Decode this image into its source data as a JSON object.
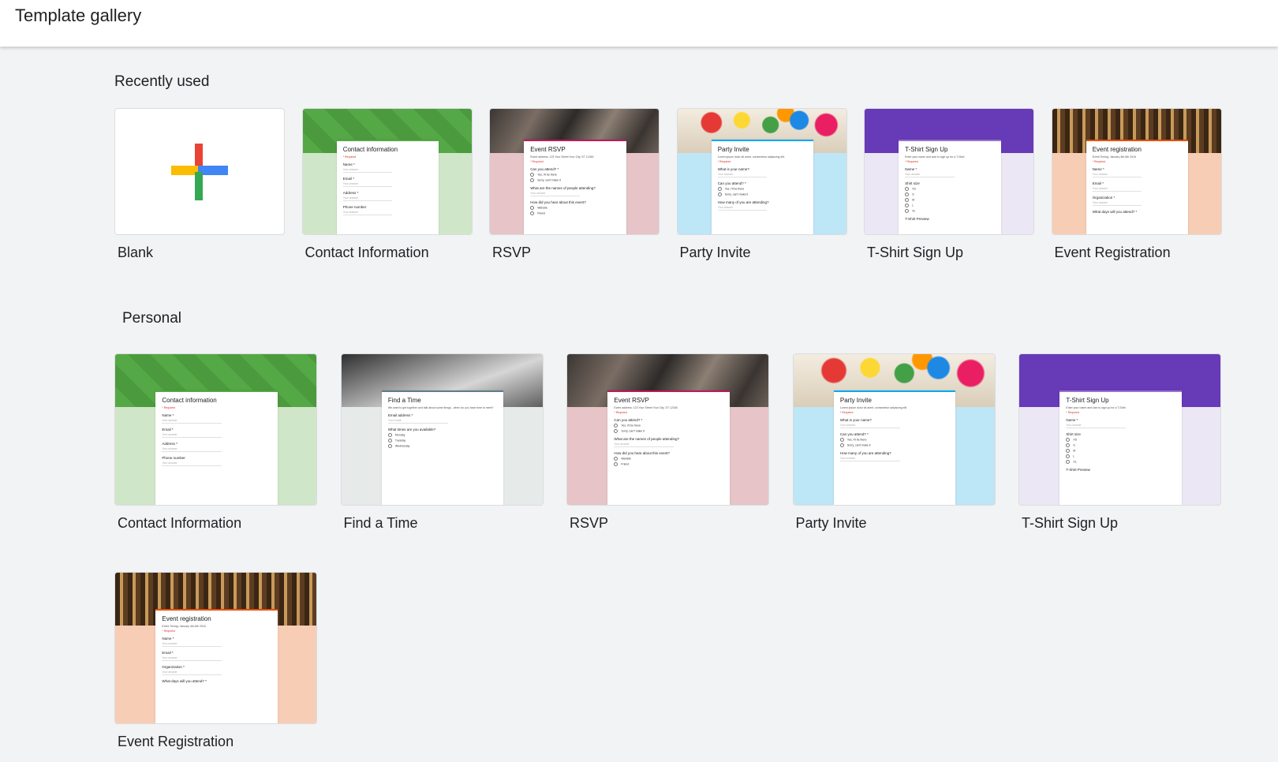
{
  "header": {
    "title": "Template gallery"
  },
  "sections": {
    "recent": "Recently used",
    "personal": "Personal"
  },
  "colors": {
    "contact": {
      "band": "#55a846",
      "body": "#d0e6c8",
      "accent": "#55a846"
    },
    "rsvp": {
      "band": "#4a4440",
      "body": "#e6c4c7",
      "accent": "#c2185b"
    },
    "party": {
      "band": "#e8d9c0",
      "body": "#bde6f6",
      "accent": "#03a9f4"
    },
    "tshirt": {
      "band": "#673ab7",
      "body": "#ece7f5",
      "accent": "#9575cd"
    },
    "event": {
      "band": "#6b4a2a",
      "body": "#f8cdb5",
      "accent": "#e65100"
    },
    "findtime": {
      "band": "#6d6d6d",
      "body": "#e6ebe9",
      "accent": "#607d8b"
    }
  },
  "templates": {
    "blank": {
      "label": "Blank",
      "icon": "plus-icon"
    },
    "contact": {
      "label": "Contact Information",
      "form_title": "Contact information",
      "required": "* Required",
      "fields": [
        {
          "q": "Name *",
          "a": "Your answer"
        },
        {
          "q": "Email *",
          "a": "Your answer"
        },
        {
          "q": "Address *",
          "a": "Your answer"
        },
        {
          "q": "Phone number",
          "a": "Your answer"
        }
      ]
    },
    "rsvp": {
      "label": "RSVP",
      "form_title": "Event RSVP",
      "desc": "Event address: 123 Your Street Your City, ST 12345",
      "required": "* Required",
      "fields": [
        {
          "q": "Can you attend? *",
          "opts": [
            "Yes, I'll be there",
            "Sorry, can't make it"
          ]
        },
        {
          "q": "What are the names of people attending?",
          "a": "Your answer"
        },
        {
          "q": "How did you hear about this event?",
          "opts": [
            "Website",
            "Friend"
          ]
        }
      ]
    },
    "party": {
      "label": "Party Invite",
      "form_title": "Party Invite",
      "desc": "Lorem ipsum dolor sit amet, consectetur adipiscing elit.",
      "required": "* Required",
      "fields": [
        {
          "q": "What is your name?",
          "a": "Your answer"
        },
        {
          "q": "Can you attend? *",
          "opts": [
            "Yes, I'll be there",
            "Sorry, can't make it"
          ]
        },
        {
          "q": "How many of you are attending?",
          "a": "Your answer"
        }
      ]
    },
    "tshirt": {
      "label": "T-Shirt Sign Up",
      "form_title": "T-Shirt Sign Up",
      "desc": "Enter your name and size to sign up for a T-Shirt.",
      "required": "* Required",
      "fields": [
        {
          "q": "Name *",
          "a": "Your answer"
        },
        {
          "q": "Shirt size",
          "opts": [
            "XS",
            "S",
            "M",
            "L",
            "XL"
          ]
        },
        {
          "q": "T-Shirt Preview"
        }
      ]
    },
    "event": {
      "label": "Event Registration",
      "form_title": "Event registration",
      "desc": "Event Timing: January 4th-6th 2016",
      "required": "* Required",
      "fields": [
        {
          "q": "Name *",
          "a": "Your answer"
        },
        {
          "q": "Email *",
          "a": "Your answer"
        },
        {
          "q": "Organization *",
          "a": "Your answer"
        },
        {
          "q": "What days will you attend? *"
        }
      ]
    },
    "findtime": {
      "label": "Find a Time",
      "form_title": "Find a Time",
      "desc": "We want to get together and talk about some things - when do you have time to meet?",
      "required": "",
      "fields": [
        {
          "q": "Email address *",
          "a": "Your email"
        },
        {
          "q": "What times are you available?",
          "opts": [
            "Monday",
            "Tuesday",
            "Wednesday"
          ]
        }
      ]
    }
  },
  "recent": [
    "blank",
    "contact",
    "rsvp",
    "party",
    "tshirt",
    "event"
  ],
  "personal": [
    "contact",
    "findtime",
    "rsvp",
    "party",
    "tshirt",
    "event"
  ]
}
